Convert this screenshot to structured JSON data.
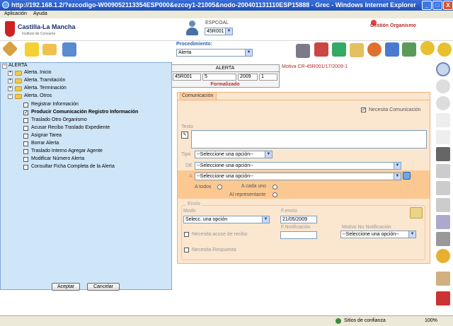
{
  "window": {
    "title": "http://192.168.1.2/?ezcodigo-W009052113354ESP000&ezcoy1-21005&nodo-200401131110ESP15888 - Grec - Windows Internet Explorer",
    "min": "_",
    "max": "□",
    "close": "X"
  },
  "menubar": {
    "items": [
      "Aplicación",
      "Ayuda"
    ]
  },
  "header": {
    "logo_title": "Castilla-La Mancha",
    "logo_subtitle": "Instituto de Consumo",
    "espcoal_label": "ESPCOAL",
    "espcoal_value": "45R001",
    "gestion": "Gestión Organismo"
  },
  "toolbar": {
    "procedimiento_label": "Procedimiento:",
    "procedimiento_value": "Alerta"
  },
  "alert": {
    "header": "ALERTA",
    "cells": [
      "45R001",
      "5",
      "2009",
      "1"
    ],
    "status": "Formalizado",
    "motiva": "Motiva CR-45R001/17/2009-1"
  },
  "tree": {
    "root": "ALERTA",
    "folders": [
      "Alerta. Inicio",
      "Alerta. Tramitación",
      "Alerta. Terminación",
      "Alerta. Otros"
    ],
    "items": [
      {
        "label": "Registrar Información",
        "checked": false
      },
      {
        "label": "Producir Comunicación Registro Información",
        "checked": true
      },
      {
        "label": "Traslado Otro Organismo",
        "checked": false
      },
      {
        "label": "Acusar Recibo Traslado Expediente",
        "checked": false
      },
      {
        "label": "Asignar Tarea",
        "checked": false
      },
      {
        "label": "Borrar Alerta",
        "checked": false
      },
      {
        "label": "Traslado Interno Agregar Agente",
        "checked": false
      },
      {
        "label": "Modificar Número Alerta",
        "checked": false
      },
      {
        "label": "Consultar Ficha Completa de la Alerta",
        "checked": false
      }
    ],
    "accept": "Aceptar",
    "cancel": "Cancelar"
  },
  "comm": {
    "tab": "Comunicación",
    "necesita_comunicacion": "Necesita Comunicación",
    "texto_label": "Texto",
    "tipo_label": "Tipo",
    "tipo_value": "--Seleccione una opción--",
    "de_label": "DE",
    "de_value": "--Seleccione una opción--",
    "a_label": "A",
    "a_value": "--Seleccione una opción--",
    "a_todos": "A todos",
    "a_cada_uno": "A cada uno",
    "al_representante": "Al representante",
    "envio_label": "Envío",
    "modo_label": "Modo",
    "modo_value": "Selecc. una opción",
    "fenvio_label": "F.envío",
    "fenvio_value": "21/05/2009",
    "fnotif_label": "F.Notificación",
    "acuse_label": "Necesita acuse de recibo",
    "motivo_label": "Motivo No Notificación",
    "motivo_value": "--Seleccione una opción--",
    "respuesta_label": "Necesita Respuesta"
  },
  "statusbar": {
    "zone": "Sitios de confianza",
    "zoom": "100%"
  }
}
